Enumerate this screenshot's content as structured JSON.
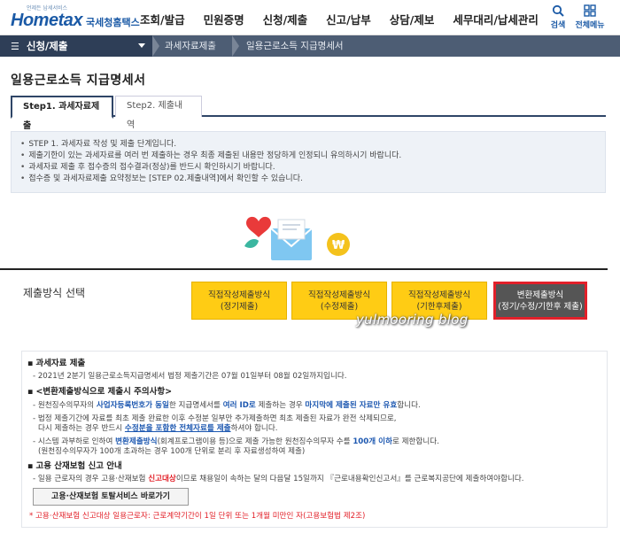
{
  "header": {
    "logo_tagline": "언제든 남세서비스",
    "logo_text": "Hometax",
    "logo_kr": "국세청홈택스",
    "menu": [
      "조회/발급",
      "민원증명",
      "신청/제출",
      "신고/납부",
      "상담/제보",
      "세무대리/납세관리"
    ],
    "search_label": "검색",
    "all_menu_label": "전체메뉴"
  },
  "navbar": {
    "current_menu": "신청/제출",
    "crumbs": [
      "과세자료제출",
      "일용근로소득 지급명세서"
    ]
  },
  "page": {
    "title": "일용근로소득 지급명세서",
    "tabs": [
      "Step1. 과세자료제출",
      "Step2. 제출내역"
    ]
  },
  "notice": [
    "STEP 1. 과세자료 작성 및 제출 단계입니다.",
    "제출기한이 있는 과세자료를 여러 번 제출하는 경우 최종 제출된 내용만 정당하게 인정되니 유의하시기 바랍니다.",
    "과세자료 제출 후 접수증의 접수결과(정상)를 반드시 확인하시기 바랍니다.",
    "접수증 및 과세자료제출 요약정보는 [STEP 02.제출내역]에서 확인할 수 있습니다."
  ],
  "method": {
    "label": "제출방식 선택",
    "buttons": [
      {
        "line1": "직접작성제출방식",
        "line2": "(정기제출)"
      },
      {
        "line1": "직접작성제출방식",
        "line2": "(수정제출)"
      },
      {
        "line1": "직접작성제출방식",
        "line2": "(기한후제출)"
      },
      {
        "line1": "변환제출방식",
        "line2": "(정기/수정/기한후 제출)"
      }
    ],
    "watermark": "yulmooring blog"
  },
  "info": {
    "sec1_title": "과세자료 제출",
    "sec1_line": "2021년 2분기 일용근로소득지급명세서 법정 제출기간은 07월 01일부터 08월 02일까지입니다.",
    "sec2_title": "<변환제출방식으로 제출시 주의사항>",
    "s2a_1": "원천징수의무자의 ",
    "s2a_2": "사업자등록번호가 동일",
    "s2a_3": "한 지급명세서를 ",
    "s2a_4": "여러 ID로",
    "s2a_5": " 제출하는 경우 ",
    "s2a_6": "마지막에 제출된 자료만 유효",
    "s2a_7": "합니다.",
    "s2b_1": "법정 제출기간에 자료를 최초 제출 완료한 이후 수정분 일부만 추가제출하면 최초 제출된 자료가 완전 삭제되므로,",
    "s2b_2a": "다시 제출하는 경우 반드시 ",
    "s2b_2b": "수정분을 포함한 전체자료를 제출",
    "s2b_2c": "하셔야 합니다.",
    "s2c_1a": "시스템 과부하로 인하여 ",
    "s2c_1b": "변환제출방식",
    "s2c_1c": "(회계프로그램이용 등)으로 제출 가능한 원천징수의무자 수를 ",
    "s2c_1d": "100개 이하",
    "s2c_1e": "로 제한합니다.",
    "s2c_2": "(원천징수의무자가 100개 초과하는 경우 100개 단위로 분리 후 자료생성하여 제출)",
    "sec3_title": "고용 산재보험 신고 안내",
    "s3_1a": "일용 근로자의 경우 고용·산재보험 ",
    "s3_1b": "신고대상",
    "s3_1c": "이므로 채용일이 속하는 달의 다음달 15일까지 『근로내용확인신고서』를 근로복지공단에 제출하여야합니다.",
    "go_button": "고용·산재보험 토탈서비스 바로가기",
    "red_note": "* 고용·산재보험 신고대상 일용근로자: 근로계약기간이 1일 단위 또는 1개월 미만인 자(고용보험법 제2조)"
  }
}
